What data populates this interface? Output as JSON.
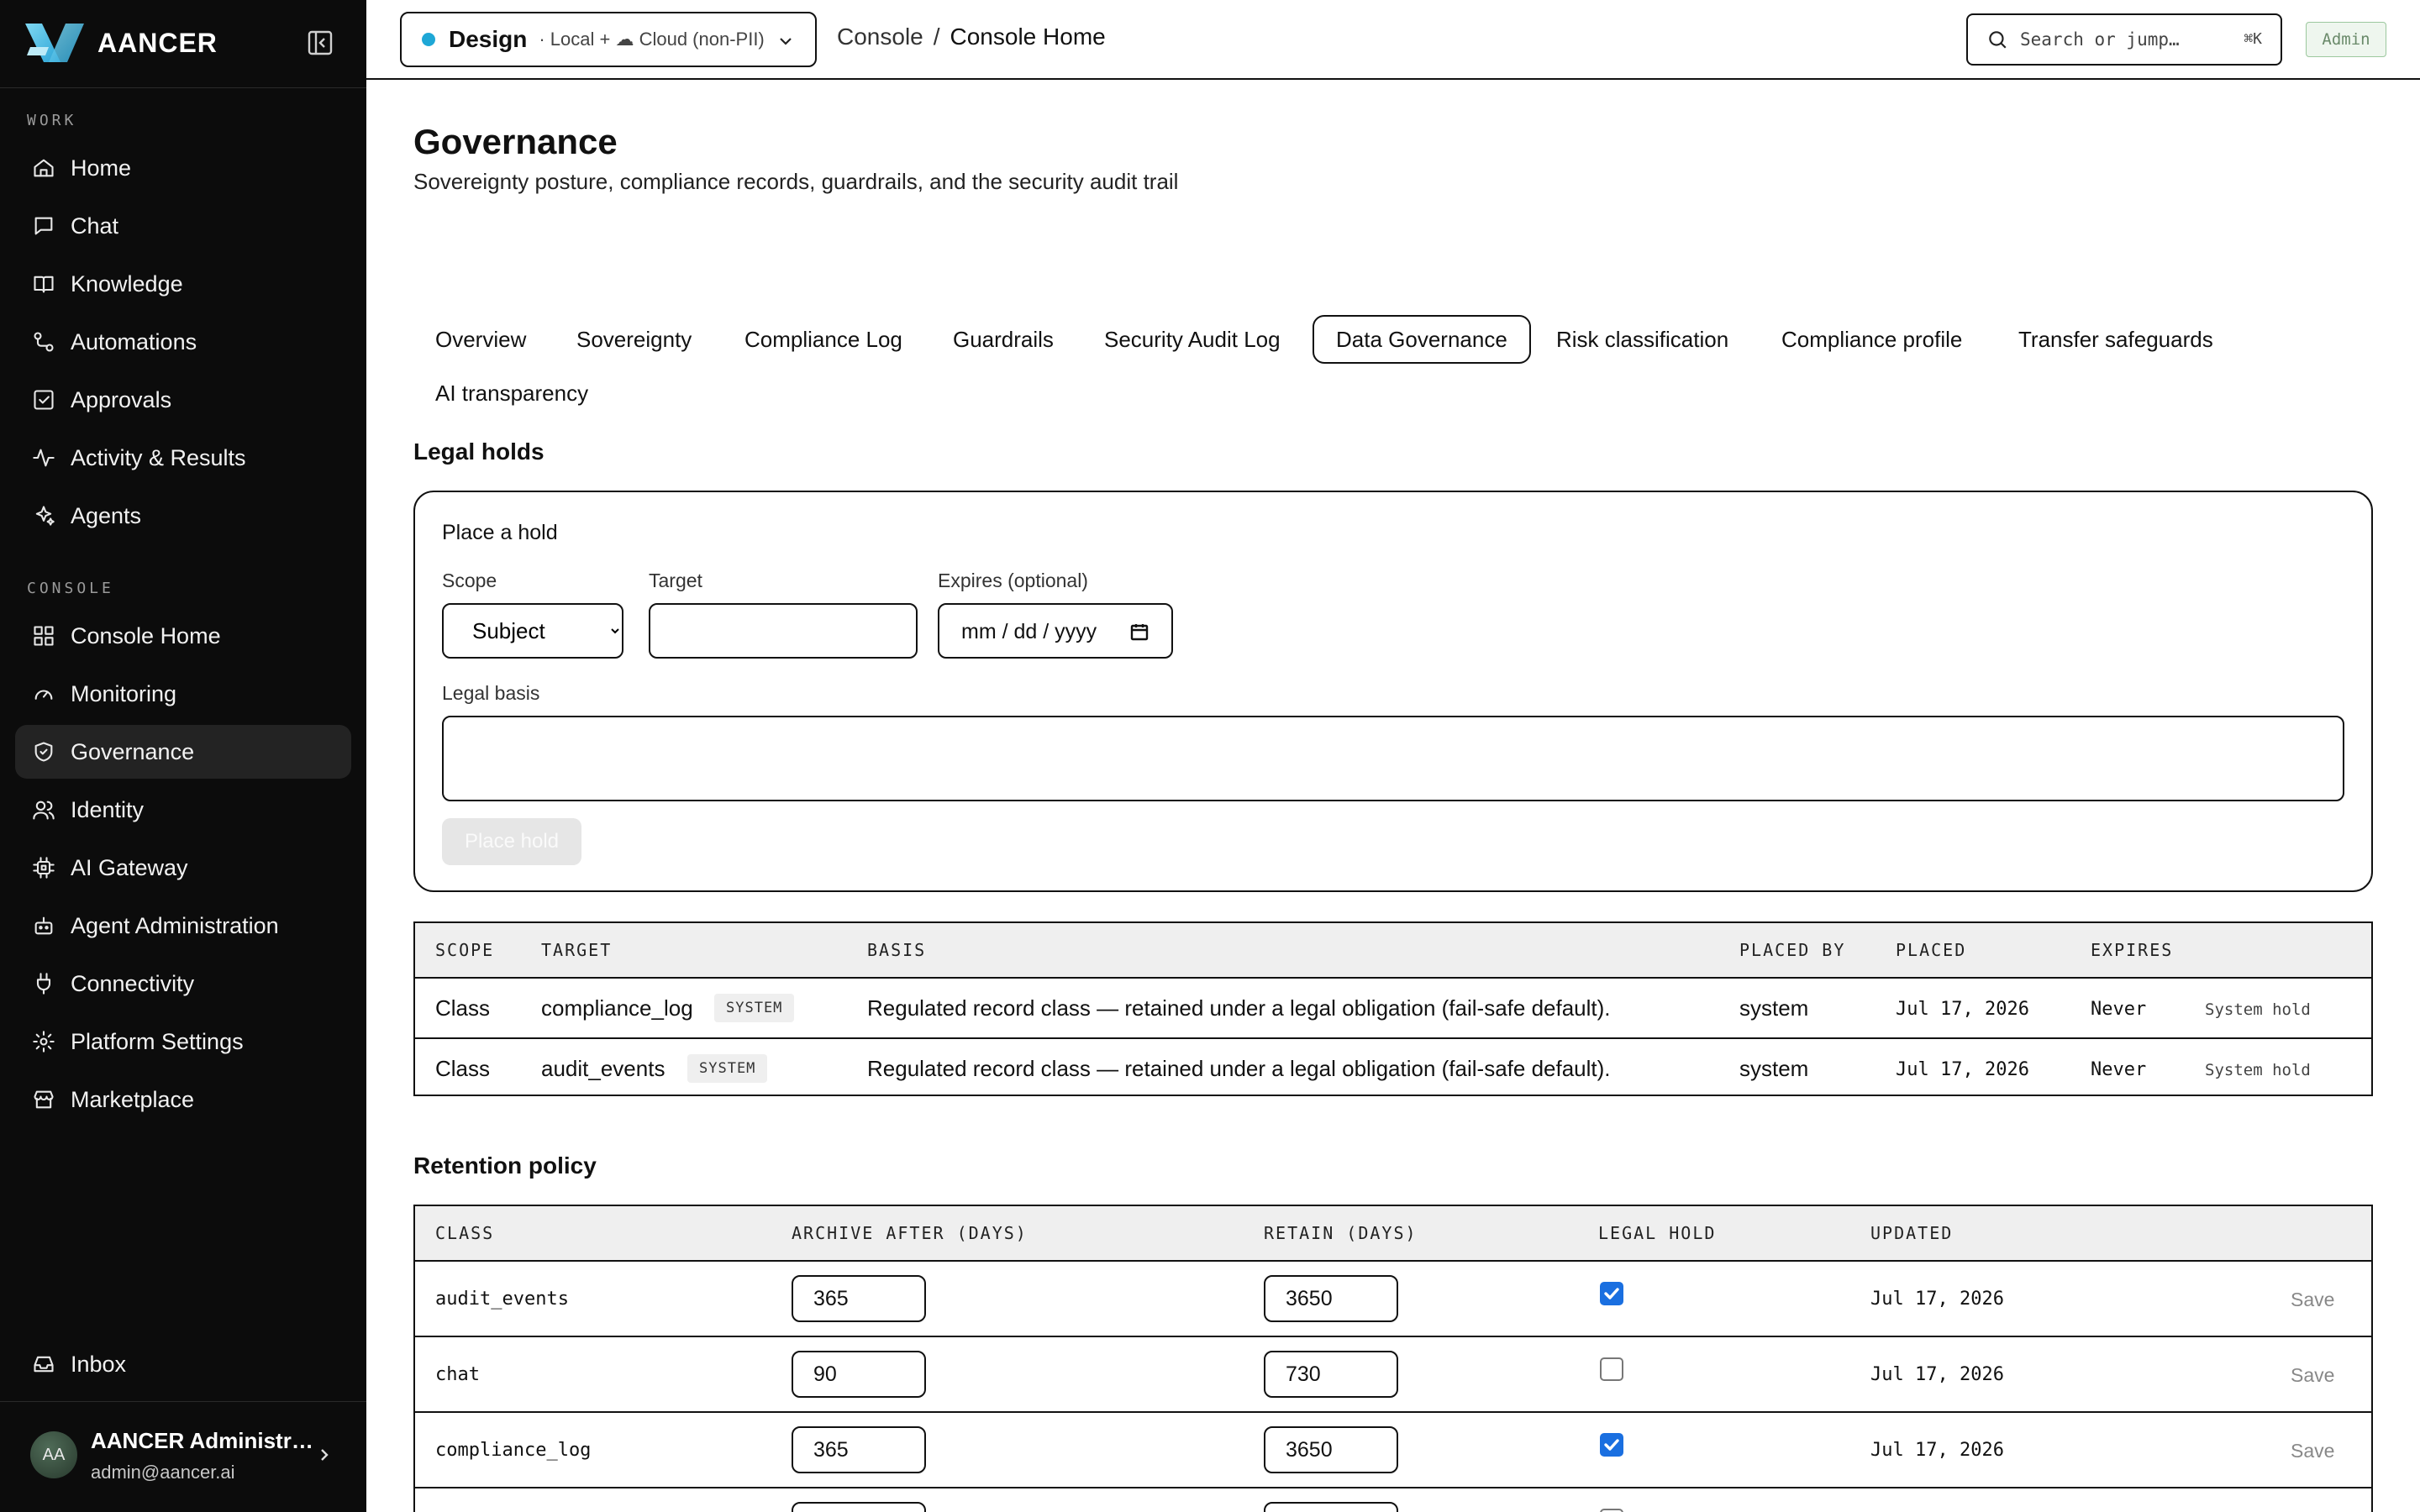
{
  "brand": {
    "name": "AANCER"
  },
  "sidebar": {
    "work_label": "WORK",
    "work_items": [
      {
        "label": "Home",
        "icon": "home-icon"
      },
      {
        "label": "Chat",
        "icon": "chat-icon"
      },
      {
        "label": "Knowledge",
        "icon": "book-icon"
      },
      {
        "label": "Automations",
        "icon": "workflow-icon"
      },
      {
        "label": "Approvals",
        "icon": "check-square-icon"
      },
      {
        "label": "Activity & Results",
        "icon": "activity-icon"
      },
      {
        "label": "Agents",
        "icon": "sparkles-icon"
      }
    ],
    "console_label": "CONSOLE",
    "console_items": [
      {
        "label": "Console Home",
        "icon": "grid-icon"
      },
      {
        "label": "Monitoring",
        "icon": "gauge-icon"
      },
      {
        "label": "Governance",
        "icon": "shield-icon",
        "active": true
      },
      {
        "label": "Identity",
        "icon": "users-icon"
      },
      {
        "label": "AI Gateway",
        "icon": "chip-icon"
      },
      {
        "label": "Agent Administration",
        "icon": "bot-icon"
      },
      {
        "label": "Connectivity",
        "icon": "plug-icon"
      },
      {
        "label": "Platform Settings",
        "icon": "gear-icon"
      },
      {
        "label": "Marketplace",
        "icon": "store-icon"
      }
    ],
    "inbox_label": "Inbox",
    "user": {
      "initials": "AA",
      "name": "AANCER Administr…",
      "email": "admin@aancer.ai"
    }
  },
  "topbar": {
    "env_name": "Design",
    "env_detail": "· Local + ☁ Cloud (non-PII)",
    "env_dot_color": "#1ea7d6",
    "breadcrumb_root": "Console",
    "breadcrumb_sep": "/",
    "breadcrumb_current": "Console Home",
    "search_placeholder": "Search or jump…",
    "search_shortcut": "⌘K",
    "role_badge": "Admin"
  },
  "page": {
    "title": "Governance",
    "subtitle": "Sovereignty posture, compliance records, guardrails, and the security audit trail",
    "tabs": [
      {
        "label": "Overview"
      },
      {
        "label": "Sovereignty"
      },
      {
        "label": "Compliance Log"
      },
      {
        "label": "Guardrails"
      },
      {
        "label": "Security Audit Log"
      },
      {
        "label": "Data Governance",
        "active": true
      },
      {
        "label": "Risk classification"
      },
      {
        "label": "Compliance profile"
      },
      {
        "label": "Transfer safeguards"
      },
      {
        "label": "AI transparency"
      }
    ]
  },
  "legal_holds": {
    "section_title": "Legal holds",
    "form": {
      "title": "Place a hold",
      "scope_label": "Scope",
      "scope_value": "Subject",
      "target_label": "Target",
      "target_value": "",
      "expires_label": "Expires (optional)",
      "expires_placeholder": "mm / dd / yyyy",
      "basis_label": "Legal basis",
      "basis_value": "",
      "submit_label": "Place hold"
    },
    "columns": [
      "SCOPE",
      "TARGET",
      "BASIS",
      "PLACED BY",
      "PLACED",
      "EXPIRES"
    ],
    "rows": [
      {
        "scope": "Class",
        "target": "compliance_log",
        "tag": "SYSTEM",
        "basis": "Regulated record class — retained under a legal obligation (fail-safe default).",
        "placed_by": "system",
        "placed": "Jul 17, 2026",
        "expires": "Never",
        "action": "System hold"
      },
      {
        "scope": "Class",
        "target": "audit_events",
        "tag": "SYSTEM",
        "basis": "Regulated record class — retained under a legal obligation (fail-safe default).",
        "placed_by": "system",
        "placed": "Jul 17, 2026",
        "expires": "Never",
        "action": "System hold"
      }
    ]
  },
  "retention": {
    "section_title": "Retention policy",
    "columns": [
      "CLASS",
      "ARCHIVE AFTER (DAYS)",
      "RETAIN (DAYS)",
      "LEGAL HOLD",
      "UPDATED"
    ],
    "rows": [
      {
        "class": "audit_events",
        "archive": "365",
        "retain": "3650",
        "legal_hold": true,
        "updated": "Jul 17, 2026",
        "action": "Save"
      },
      {
        "class": "chat",
        "archive": "90",
        "retain": "730",
        "legal_hold": false,
        "updated": "Jul 17, 2026",
        "action": "Save"
      },
      {
        "class": "compliance_log",
        "archive": "365",
        "retain": "3650",
        "legal_hold": true,
        "updated": "Jul 17, 2026",
        "action": "Save"
      }
    ]
  }
}
